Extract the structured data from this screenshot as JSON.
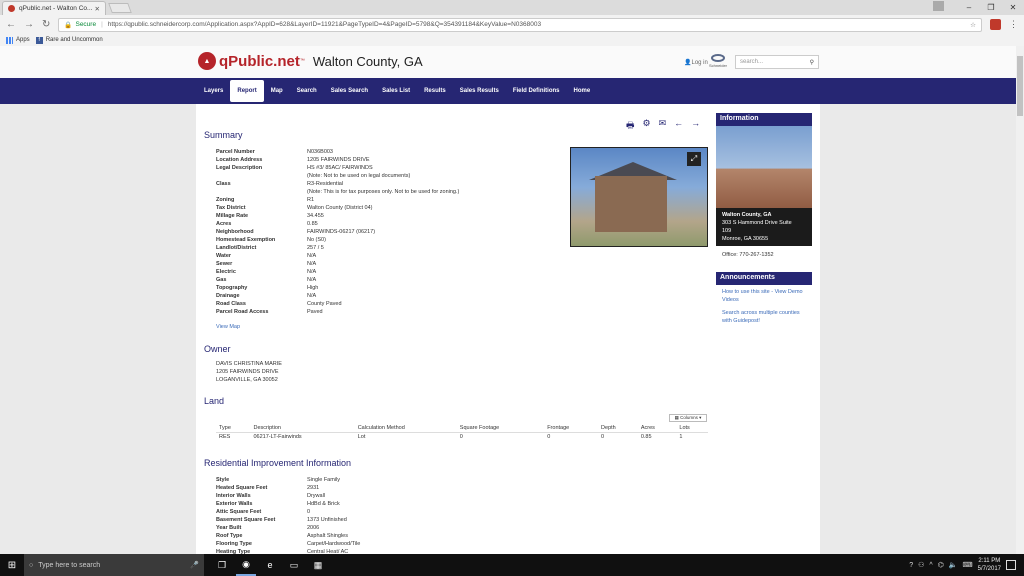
{
  "browser": {
    "tab_title": "qPublic.net - Walton Co...",
    "secure_label": "Secure",
    "url": "https://qpublic.schneidercorp.com/Application.aspx?AppID=628&LayerID=11921&PageTypeID=4&PageID=5798&Q=354391184&KeyValue=N0368003",
    "bookmarks": [
      {
        "label": "Apps"
      },
      {
        "label": "Rare and Uncommon"
      }
    ]
  },
  "header": {
    "logo": "qPublic.net",
    "county": "Walton County, GA",
    "login": "Log in",
    "schneider": "Schneider",
    "search_placeholder": "search..."
  },
  "nav": {
    "items": [
      "Layers",
      "Report",
      "Map",
      "Search",
      "Sales Search",
      "Sales List",
      "Results",
      "Sales Results",
      "Field Definitions",
      "Home"
    ],
    "active": "Report"
  },
  "summary": {
    "title": "Summary",
    "rows": [
      {
        "k": "Parcel Number",
        "v": "N036B003"
      },
      {
        "k": "Location Address",
        "v": "1205 FAIRWINDS DRIVE"
      },
      {
        "k": "Legal Description",
        "v": "HS #3/ 85AC/ FAIRWINDS"
      },
      {
        "k": "",
        "v": "(Note: Not to be used on legal documents)",
        "note": true
      },
      {
        "k": "Class",
        "v": "R3-Residential"
      },
      {
        "k": "",
        "v": "(Note: This is for tax purposes only. Not to be used for zoning.)",
        "note": true
      },
      {
        "k": "Zoning",
        "v": "R1"
      },
      {
        "k": "Tax District",
        "v": "Walton County (District 04)"
      },
      {
        "k": "Millage Rate",
        "v": "34.455"
      },
      {
        "k": "Acres",
        "v": "0.85"
      },
      {
        "k": "Neighborhood",
        "v": "FAIRWINDS-06217 (06217)"
      },
      {
        "k": "Homestead Exemption",
        "v": "No (S0)"
      },
      {
        "k": "Landlot/District",
        "v": "257 / 5"
      },
      {
        "k": "Water",
        "v": "N/A"
      },
      {
        "k": "Sewer",
        "v": "N/A"
      },
      {
        "k": "Electric",
        "v": "N/A"
      },
      {
        "k": "Gas",
        "v": "N/A"
      },
      {
        "k": "Topography",
        "v": "High"
      },
      {
        "k": "Drainage",
        "v": "N/A"
      },
      {
        "k": "Road Class",
        "v": "County Paved"
      },
      {
        "k": "Parcel Road Access",
        "v": "Paved"
      }
    ],
    "view_map": "View Map"
  },
  "owner": {
    "title": "Owner",
    "name": "DAVIS CHRISTINA MARIE",
    "addr1": "1205 FAIRWINDS DRIVE",
    "addr2": "LOGANVILLE, GA 30052"
  },
  "land": {
    "title": "Land",
    "columns_btn": "Columns",
    "headers": [
      "Type",
      "Description",
      "Calculation Method",
      "Square Footage",
      "Frontage",
      "Depth",
      "Acres",
      "Lots"
    ],
    "rows": [
      [
        "RES",
        "06217-LT-Fairwinds",
        "Lot",
        "0",
        "0",
        "0",
        "0.85",
        "1"
      ]
    ]
  },
  "residential": {
    "title": "Residential Improvement Information",
    "rows": [
      {
        "k": "Style",
        "v": "Single Family"
      },
      {
        "k": "Heated Square Feet",
        "v": "2931"
      },
      {
        "k": "Interior Walls",
        "v": "Drywall"
      },
      {
        "k": "Exterior Walls",
        "v": "HdBd & Brick"
      },
      {
        "k": "Attic Square Feet",
        "v": "0"
      },
      {
        "k": "Basement Square Feet",
        "v": "1373 Unfinished"
      },
      {
        "k": "Year Built",
        "v": "2006"
      },
      {
        "k": "Roof Type",
        "v": "Asphalt Shingles"
      },
      {
        "k": "Flooring Type",
        "v": "Carpet/Hardwood/Tile"
      },
      {
        "k": "Heating Type",
        "v": "Central Heat/ AC"
      }
    ]
  },
  "sidebar": {
    "info_title": "Information",
    "caption_name": "Walton County, GA",
    "caption_addr1": "303 S Hammond Drive Suite",
    "caption_addr2": "109",
    "caption_addr3": "Monroe, GA 30655",
    "office": "Office: 770-267-1352",
    "ann_title": "Announcements",
    "ann_links": [
      "How to use this site - View Demo Videos",
      "Search across multiple counties with Guidepost!"
    ]
  },
  "taskbar": {
    "search_placeholder": "Type here to search",
    "time": "2:11 PM",
    "date": "5/7/2017"
  }
}
